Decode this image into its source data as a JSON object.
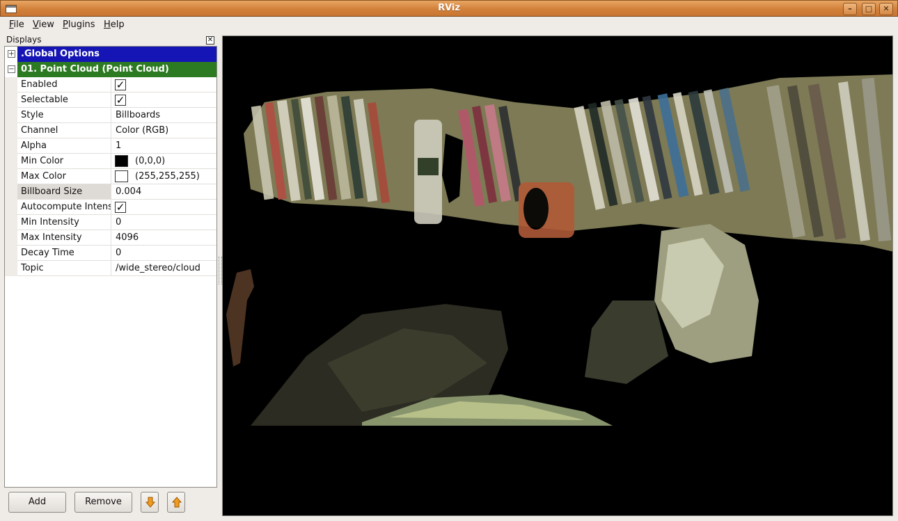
{
  "window": {
    "title": "RViz"
  },
  "menu": [
    {
      "label": "File",
      "mnemonic": "F",
      "rest": "ile"
    },
    {
      "label": "View",
      "mnemonic": "V",
      "rest": "iew"
    },
    {
      "label": "Plugins",
      "mnemonic": "P",
      "rest": "lugins"
    },
    {
      "label": "Help",
      "mnemonic": "H",
      "rest": "elp"
    }
  ],
  "displays_panel": {
    "title": "Displays",
    "categories": [
      {
        "label": ".Global Options",
        "expanded": false,
        "color": "#1515b5"
      },
      {
        "label": "01. Point Cloud (Point Cloud)",
        "expanded": true,
        "color": "#2c7a22"
      }
    ],
    "properties": [
      {
        "name": "Enabled",
        "type": "checkbox",
        "checked": true
      },
      {
        "name": "Selectable",
        "type": "checkbox",
        "checked": true
      },
      {
        "name": "Style",
        "type": "text",
        "value": "Billboards"
      },
      {
        "name": "Channel",
        "type": "text",
        "value": "Color (RGB)"
      },
      {
        "name": "Alpha",
        "type": "text",
        "value": "1"
      },
      {
        "name": "Min Color",
        "type": "color",
        "swatch": "#000000",
        "value": "(0,0,0)"
      },
      {
        "name": "Max Color",
        "type": "color",
        "swatch": "#ffffff",
        "value": "(255,255,255)"
      },
      {
        "name": "Billboard Size",
        "type": "text",
        "value": "0.004",
        "selected": true
      },
      {
        "name": "Autocompute Intens",
        "type": "checkbox",
        "checked": true
      },
      {
        "name": "Min Intensity",
        "type": "text",
        "value": "0"
      },
      {
        "name": "Max Intensity",
        "type": "text",
        "value": "4096"
      },
      {
        "name": "Decay Time",
        "type": "text",
        "value": "0"
      },
      {
        "name": "Topic",
        "type": "text",
        "value": "/wide_stereo/cloud"
      }
    ],
    "buttons": {
      "add": "Add",
      "remove": "Remove"
    }
  },
  "colors": {
    "global_options_bg": "#1515b5",
    "point_cloud_bg": "#2c7a22",
    "titlebar_accent": "#d2813a",
    "viewport_bg": "#000000"
  },
  "icons": [
    "window-menu-icon",
    "minimize-icon",
    "maximize-icon",
    "close-icon",
    "panel-close-icon",
    "expand-icon",
    "collapse-icon",
    "move-down-arrow-icon",
    "move-up-arrow-icon",
    "checkmark-icon"
  ]
}
